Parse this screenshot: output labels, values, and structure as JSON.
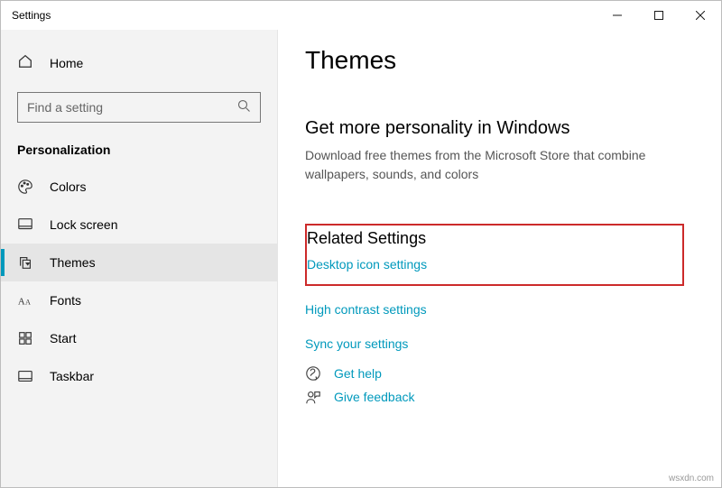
{
  "window": {
    "title": "Settings"
  },
  "sidebar": {
    "home": "Home",
    "search_placeholder": "Find a setting",
    "category": "Personalization",
    "items": [
      {
        "label": "Colors"
      },
      {
        "label": "Lock screen"
      },
      {
        "label": "Themes"
      },
      {
        "label": "Fonts"
      },
      {
        "label": "Start"
      },
      {
        "label": "Taskbar"
      }
    ]
  },
  "main": {
    "title": "Themes",
    "section_heading": "Get more personality in Windows",
    "section_desc": "Download free themes from the Microsoft Store that combine wallpapers, sounds, and colors",
    "related_heading": "Related Settings",
    "links": {
      "desktop_icon": "Desktop icon settings",
      "high_contrast": "High contrast settings",
      "sync": "Sync your settings",
      "help": "Get help",
      "feedback": "Give feedback"
    }
  },
  "watermark": "wsxdn.com"
}
